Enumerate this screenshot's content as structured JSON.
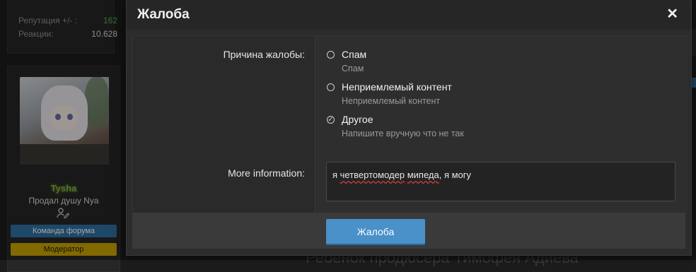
{
  "background": {
    "stats": [
      {
        "label": "Репутация +/- :",
        "value": "162"
      },
      {
        "label": "Реакции:",
        "value": "10.628"
      }
    ],
    "user": {
      "name": "Tysha",
      "title": "Продал душу Nya",
      "badges": [
        "Команда форума",
        "Модератор"
      ]
    },
    "bottom_text": "Ребёнок продюсера Тимофея Адиева"
  },
  "modal": {
    "title": "Жалоба",
    "reason_label": "Причина жалобы:",
    "options": [
      {
        "label": "Спам",
        "hint": "Спам",
        "checked": false
      },
      {
        "label": "Неприемлемый контент",
        "hint": "Неприемлемый контент",
        "checked": false
      },
      {
        "label": "Другое",
        "hint": "Напишите вручную что не так",
        "checked": true
      }
    ],
    "more_label": "More information:",
    "more_value_prefix": "я ",
    "more_value_misspelled_1": "четвертомодер",
    "more_value_space": " ",
    "more_value_misspelled_2": "мипеда",
    "more_value_suffix": ", я могу",
    "submit_label": "Жалоба"
  },
  "colors": {
    "accent": "#4a90c9",
    "team_badge": "#2e6f9e",
    "mod_badge": "#c8a200",
    "username": "#7fae3a",
    "reputation": "#4caf50"
  }
}
